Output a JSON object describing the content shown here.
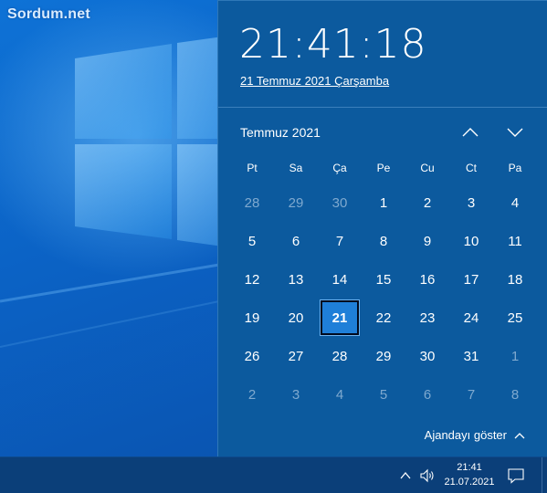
{
  "desktop": {
    "watermark": "Sordum.net"
  },
  "flyout": {
    "time": "21:41:18",
    "date_link": "21 Temmuz 2021 Çarşamba",
    "month_label": "Temmuz 2021",
    "weekdays": [
      "Pt",
      "Sa",
      "Ça",
      "Pe",
      "Cu",
      "Ct",
      "Pa"
    ],
    "days": [
      {
        "label": "28",
        "dim": true
      },
      {
        "label": "29",
        "dim": true
      },
      {
        "label": "30",
        "dim": true
      },
      {
        "label": "1"
      },
      {
        "label": "2"
      },
      {
        "label": "3"
      },
      {
        "label": "4"
      },
      {
        "label": "5"
      },
      {
        "label": "6"
      },
      {
        "label": "7"
      },
      {
        "label": "8"
      },
      {
        "label": "9"
      },
      {
        "label": "10"
      },
      {
        "label": "11"
      },
      {
        "label": "12"
      },
      {
        "label": "13"
      },
      {
        "label": "14"
      },
      {
        "label": "15"
      },
      {
        "label": "16"
      },
      {
        "label": "17"
      },
      {
        "label": "18"
      },
      {
        "label": "19"
      },
      {
        "label": "20"
      },
      {
        "label": "21",
        "today": true
      },
      {
        "label": "22"
      },
      {
        "label": "23"
      },
      {
        "label": "24"
      },
      {
        "label": "25"
      },
      {
        "label": "26"
      },
      {
        "label": "27"
      },
      {
        "label": "28"
      },
      {
        "label": "29"
      },
      {
        "label": "30"
      },
      {
        "label": "31"
      },
      {
        "label": "1",
        "dim": true
      },
      {
        "label": "2",
        "dim": true
      },
      {
        "label": "3",
        "dim": true
      },
      {
        "label": "4",
        "dim": true
      },
      {
        "label": "5",
        "dim": true
      },
      {
        "label": "6",
        "dim": true
      },
      {
        "label": "7",
        "dim": true
      },
      {
        "label": "8",
        "dim": true
      }
    ],
    "agenda_label": "Ajandayı göster",
    "icons": {
      "prev": "chevron-up-icon",
      "next": "chevron-down-icon",
      "agenda": "chevron-up-icon"
    }
  },
  "taskbar": {
    "clock_time": "21:41",
    "clock_date": "21.07.2021",
    "icons": [
      "show-hidden-icons-icon",
      "speaker-icon",
      "notification-icon"
    ]
  },
  "colors": {
    "flyout_bg": "#0c5a9e",
    "taskbar_bg": "#0b3f79",
    "today_bg": "#1f7fd8",
    "dim_text": "#7fa9cf"
  }
}
